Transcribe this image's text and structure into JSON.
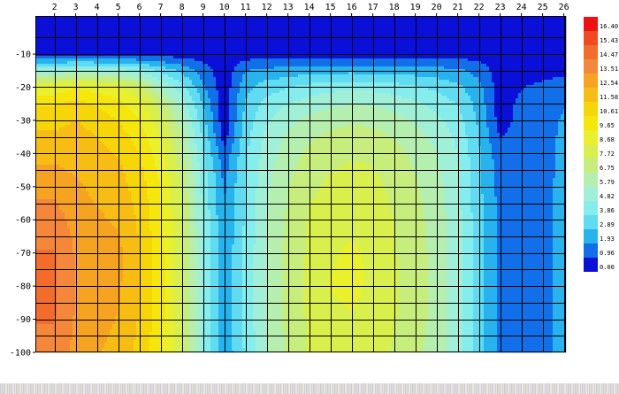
{
  "chart_data": {
    "type": "heatmap",
    "title": "",
    "xlabel": "",
    "ylabel": "",
    "x_ticks": [
      2,
      3,
      4,
      5,
      6,
      7,
      8,
      9,
      10,
      11,
      12,
      13,
      14,
      15,
      16,
      17,
      18,
      19,
      20,
      21,
      22,
      23,
      24,
      25,
      26
    ],
    "y_ticks": [
      -10,
      -20,
      -30,
      -40,
      -50,
      -60,
      -70,
      -80,
      -90,
      -100
    ],
    "xlim": [
      1.1,
      26.1
    ],
    "ylim": [
      -100,
      1.5
    ],
    "grid": true,
    "legend": {
      "placement": "right",
      "levels": [
        "16.40",
        "15.43",
        "14.47",
        "13.51",
        "12.54",
        "11.58",
        "10.61",
        "9.65",
        "8.68",
        "7.72",
        "6.75",
        "5.79",
        "4.82",
        "3.86",
        "2.89",
        "1.93",
        "0.96",
        "0.00"
      ],
      "colors": [
        "#ee1111",
        "#f24a20",
        "#f36c2c",
        "#f5873a",
        "#f7a322",
        "#f8bd12",
        "#f6d607",
        "#f5e70c",
        "#eaf02a",
        "#d8ef4c",
        "#c7ee7c",
        "#b5efb0",
        "#9ff0d6",
        "#85edeb",
        "#5fdcf2",
        "#27b3ee",
        "#106fe9",
        "#0a10d8"
      ]
    },
    "x_columns": [
      2,
      3,
      4,
      5,
      6,
      7,
      8,
      9,
      10,
      11,
      12,
      13,
      14,
      15,
      16,
      17,
      18,
      19,
      20,
      21,
      22,
      23,
      24,
      25,
      26
    ],
    "depth_rows": [
      -10,
      -15,
      -20,
      -25,
      -30,
      -35,
      -40,
      -45,
      -50,
      -55,
      -60,
      -65,
      -70,
      -75,
      -80,
      -85,
      -90,
      -95,
      -100
    ],
    "grid_values": [
      [
        0.5,
        0.5,
        0.5,
        0.5,
        0.5,
        0.5,
        0.5,
        0.4,
        0.3,
        0.4,
        0.5,
        0.5,
        0.5,
        0.5,
        0.5,
        0.5,
        0.5,
        0.5,
        0.5,
        0.5,
        0.5,
        0.4,
        0.4,
        0.4,
        0.5
      ],
      [
        5.0,
        5.4,
        5.2,
        5.0,
        4.6,
        3.6,
        2.6,
        1.5,
        0.3,
        1.9,
        2.2,
        2.3,
        2.5,
        2.6,
        2.6,
        2.6,
        2.5,
        2.4,
        2.3,
        2.1,
        1.6,
        0.4,
        0.5,
        0.6,
        0.7
      ],
      [
        9.0,
        9.6,
        9.2,
        8.8,
        7.8,
        5.9,
        4.2,
        2.1,
        0.3,
        2.6,
        3.4,
        3.8,
        4.2,
        4.5,
        4.6,
        4.5,
        4.3,
        4.0,
        3.6,
        3.1,
        2.2,
        0.4,
        0.9,
        1.2,
        1.5
      ],
      [
        10.5,
        11.0,
        10.5,
        10.0,
        9.0,
        7.3,
        5.4,
        2.8,
        0.3,
        3.0,
        4.2,
        4.8,
        5.3,
        5.6,
        5.8,
        5.7,
        5.4,
        5.0,
        4.5,
        3.8,
        2.5,
        0.5,
        1.2,
        1.6,
        1.9
      ],
      [
        11.2,
        11.6,
        11.1,
        10.6,
        9.7,
        8.1,
        6.2,
        3.3,
        0.3,
        3.3,
        4.7,
        5.5,
        6.1,
        6.4,
        6.6,
        6.5,
        6.2,
        5.7,
        5.1,
        4.3,
        2.7,
        0.5,
        1.3,
        1.7,
        2.0
      ],
      [
        11.8,
        12.0,
        11.6,
        11.1,
        10.2,
        8.7,
        6.7,
        3.7,
        0.5,
        3.5,
        5.1,
        6.0,
        6.6,
        7.0,
        7.2,
        7.1,
        6.7,
        6.2,
        5.5,
        4.6,
        2.9,
        0.9,
        1.4,
        1.8,
        2.0
      ],
      [
        12.3,
        12.2,
        11.9,
        11.5,
        10.6,
        9.1,
        7.1,
        4.0,
        1.2,
        3.7,
        5.3,
        6.3,
        7.0,
        7.4,
        7.6,
        7.5,
        7.1,
        6.5,
        5.8,
        4.8,
        3.0,
        1.3,
        1.5,
        1.8,
        2.0
      ],
      [
        12.7,
        12.4,
        12.1,
        11.8,
        10.9,
        9.4,
        7.4,
        4.3,
        1.6,
        3.8,
        5.5,
        6.5,
        7.3,
        7.7,
        7.9,
        7.8,
        7.3,
        6.7,
        6.0,
        5.0,
        3.1,
        1.5,
        1.5,
        1.8,
        2.0
      ],
      [
        13.2,
        12.7,
        12.3,
        12.0,
        11.1,
        9.6,
        7.6,
        4.5,
        1.8,
        3.9,
        5.6,
        6.7,
        7.5,
        7.9,
        8.1,
        8.0,
        7.5,
        6.9,
        6.1,
        5.1,
        3.1,
        1.6,
        1.5,
        1.8,
        2.1
      ],
      [
        13.6,
        12.9,
        12.5,
        12.2,
        11.3,
        9.7,
        7.7,
        4.6,
        1.9,
        4.0,
        5.7,
        6.8,
        7.7,
        8.1,
        8.3,
        8.1,
        7.6,
        7.0,
        6.2,
        5.1,
        3.2,
        1.6,
        1.5,
        1.8,
        2.1
      ],
      [
        14.0,
        13.1,
        12.7,
        12.4,
        11.4,
        9.8,
        7.8,
        4.7,
        2.0,
        4.0,
        5.8,
        6.9,
        7.8,
        8.2,
        8.4,
        8.2,
        7.7,
        7.1,
        6.3,
        5.2,
        3.2,
        1.6,
        1.5,
        1.8,
        2.1
      ],
      [
        14.3,
        13.3,
        12.8,
        12.6,
        11.5,
        9.9,
        7.9,
        4.8,
        2.0,
        4.1,
        5.8,
        7.0,
        7.9,
        8.4,
        8.6,
        8.3,
        7.8,
        7.1,
        6.3,
        5.2,
        3.2,
        1.6,
        1.5,
        1.8,
        2.1
      ],
      [
        14.5,
        13.4,
        12.9,
        12.8,
        11.6,
        10.0,
        8.0,
        4.8,
        2.1,
        4.1,
        5.9,
        7.0,
        7.9,
        8.5,
        8.9,
        8.4,
        7.8,
        7.2,
        6.4,
        5.2,
        3.2,
        1.6,
        1.5,
        1.8,
        2.1
      ],
      [
        14.6,
        13.5,
        12.9,
        12.8,
        11.6,
        10.0,
        8.0,
        4.8,
        2.1,
        4.1,
        5.9,
        7.0,
        8.0,
        8.6,
        9.1,
        8.4,
        7.9,
        7.2,
        6.4,
        5.2,
        3.2,
        1.6,
        1.5,
        1.8,
        2.1
      ],
      [
        14.6,
        13.5,
        12.9,
        12.7,
        11.6,
        10.0,
        8.0,
        4.8,
        2.1,
        4.1,
        5.9,
        7.0,
        8.0,
        8.8,
        9.0,
        8.4,
        7.9,
        7.2,
        6.4,
        5.2,
        3.2,
        1.6,
        1.5,
        1.8,
        2.1
      ],
      [
        14.6,
        13.5,
        12.9,
        12.6,
        11.6,
        10.0,
        8.0,
        4.8,
        2.1,
        4.1,
        5.9,
        7.0,
        8.0,
        8.5,
        8.8,
        8.4,
        7.9,
        7.2,
        6.4,
        5.2,
        3.2,
        1.6,
        1.5,
        1.8,
        2.1
      ],
      [
        14.5,
        13.4,
        12.8,
        12.5,
        11.5,
        10.0,
        8.0,
        4.8,
        2.1,
        4.1,
        5.9,
        7.0,
        7.9,
        8.4,
        8.6,
        8.3,
        7.8,
        7.2,
        6.4,
        5.2,
        3.2,
        1.6,
        1.5,
        1.8,
        2.1
      ],
      [
        14.4,
        13.3,
        12.7,
        12.4,
        11.4,
        9.9,
        7.9,
        4.8,
        2.1,
        4.1,
        5.8,
        7.0,
        7.9,
        8.3,
        8.5,
        8.2,
        7.7,
        7.1,
        6.3,
        5.2,
        3.2,
        1.6,
        1.5,
        1.8,
        2.1
      ],
      [
        14.3,
        13.2,
        12.6,
        12.3,
        11.3,
        9.8,
        7.8,
        4.8,
        2.1,
        4.0,
        5.8,
        6.9,
        7.8,
        8.2,
        8.4,
        8.1,
        7.6,
        7.0,
        6.3,
        5.2,
        3.2,
        1.6,
        1.5,
        1.8,
        2.1
      ]
    ]
  }
}
